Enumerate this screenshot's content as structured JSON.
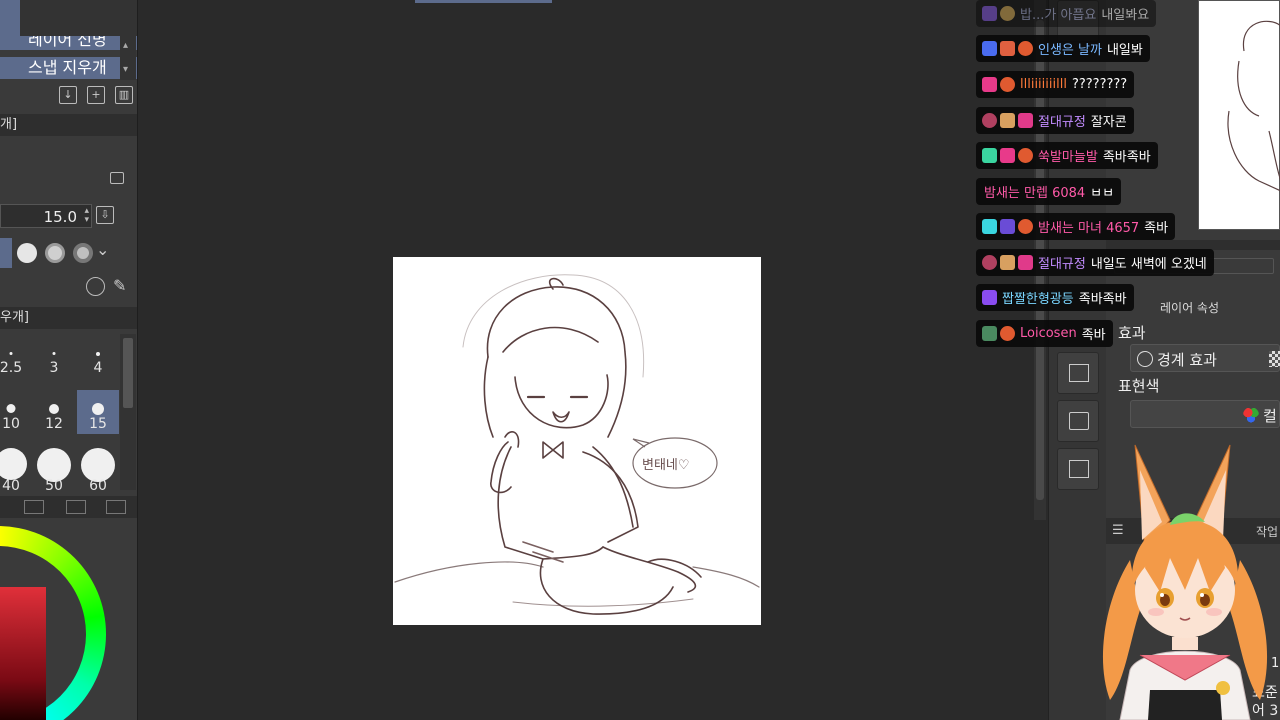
{
  "left_panel": {
    "layer_label_partial": "레이어 선명",
    "snap_eraser_label": "스냅 지우개",
    "section_header_1": "개]",
    "brush_size_value": "15.0",
    "section_header_2": "우개]",
    "brush_sizes": [
      {
        "label": "2.5",
        "selected": false
      },
      {
        "label": "3",
        "selected": false
      },
      {
        "label": "4",
        "selected": false
      },
      {
        "label": "10",
        "selected": false
      },
      {
        "label": "12",
        "selected": false
      },
      {
        "label": "15",
        "selected": true
      },
      {
        "label": "40",
        "selected": false
      },
      {
        "label": "50",
        "selected": false
      },
      {
        "label": "60",
        "selected": false
      }
    ]
  },
  "canvas": {
    "speech_text": "변태네♡"
  },
  "right_panel": {
    "tab_layer_props": "레이어 속성",
    "effect_label": "효과",
    "border_effect": "경계 효과",
    "expression_color_label": "표현색",
    "color_option_partial": "컬",
    "work_label_partial": "작업",
    "bottom_label_1": "표준",
    "bottom_label_2": "어 3",
    "bottom_label_3": "표",
    "bottom_num": "1"
  },
  "chat": [
    {
      "nick": "밥...가 아픕요",
      "nick_color": "#9aa0c8",
      "msg": "내일봐요",
      "badges": [
        "#7b4fd6",
        "#c8a04a"
      ]
    },
    {
      "nick": "인생은 날까",
      "nick_color": "#7ab8ff",
      "msg": "내일봐",
      "badges": [
        "#4a6cf0",
        "#e06040",
        "#e05a30"
      ]
    },
    {
      "nick": "llliiiiiiilll",
      "nick_color": "#ff7a3a",
      "msg": "????????",
      "badges": [
        "#e83a8a",
        "#e05a30"
      ]
    },
    {
      "nick": "절대규정",
      "nick_color": "#c28cff",
      "msg": "잘자콘",
      "badges": [
        "#b04060",
        "#d8a060",
        "#e03a8a"
      ]
    },
    {
      "nick": "쑥발마늘발",
      "nick_color": "#ff5aa8",
      "msg": "족바족바",
      "badges": [
        "#3ad6a0",
        "#e83a8a",
        "#e05a30"
      ]
    },
    {
      "nick": "밤새는 만렙 6084",
      "nick_color": "#ff5aa8",
      "msg": "ㅂㅂ",
      "badges": []
    },
    {
      "nick": "밤새는 마녀 4657",
      "nick_color": "#ff5aa8",
      "msg": "족바",
      "badges": [
        "#3ad6e0",
        "#6a4cd6",
        "#e05a30"
      ]
    },
    {
      "nick": "절대규정",
      "nick_color": "#c28cff",
      "msg": "내일도 새벽에 오겠네",
      "badges": [
        "#b04060",
        "#d8a060",
        "#e03a8a"
      ]
    },
    {
      "nick": "짭짤한형광등",
      "nick_color": "#7ad6ff",
      "msg": "족바족바",
      "badges": [
        "#8a4cf0"
      ]
    },
    {
      "nick": "Loicosen",
      "nick_color": "#ff5aa8",
      "msg": "족바",
      "badges": [
        "#4a8a60",
        "#e05a30"
      ]
    }
  ]
}
